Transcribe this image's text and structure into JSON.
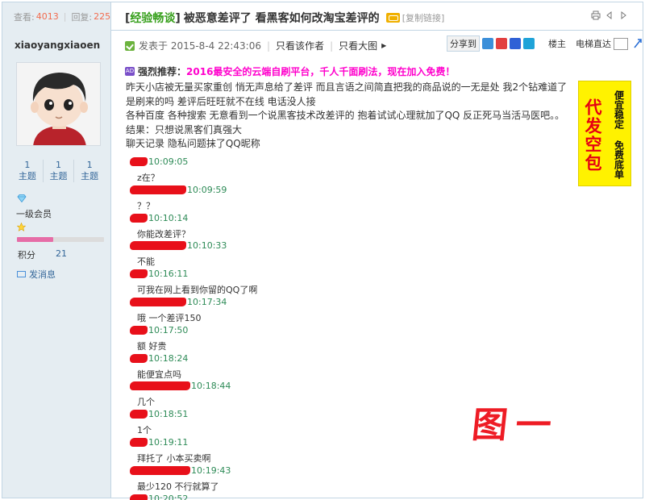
{
  "header": {
    "views_label": "查看:",
    "views_count": "4013",
    "replies_label": "回复:",
    "replies_count": "225",
    "category_open": "[",
    "category": "经验畅谈",
    "category_close": "]",
    "title": "被恶意差评了 看黑客如何改淘宝差评的",
    "copy_link": "[复制链接]",
    "icons": [
      "print-icon",
      "prev-thread-icon",
      "next-thread-icon"
    ]
  },
  "user": {
    "name": "xiaoyangxiaoen",
    "stats": [
      {
        "value": "1",
        "label": "主题"
      },
      {
        "value": "1",
        "label": "主题"
      },
      {
        "value": "1",
        "label": "主题"
      }
    ],
    "level": "一级会员",
    "level_progress": 0.42,
    "score_label": "积分",
    "score": "21",
    "message_label": "发消息"
  },
  "post": {
    "posted_at": "发表于 2015-8-4 22:43:06",
    "author_only": "只看该作者",
    "large_image": "只看大图",
    "share_label": "分享到",
    "share_icons": [
      "qzone-icon",
      "weibo-icon",
      "baidu-icon",
      "tencent-weibo-icon"
    ],
    "floor_label": "楼主",
    "jump_label": "电梯直达",
    "recommend_label": "强烈推荐：",
    "recommend_text": "2016最安全的云端自刷平台，千人千面刷法，现在加入免费！",
    "paragraphs": [
      "昨天小店被无量买家重创 悄无声息给了差评 而且言语之间简直把我的商品说的一无是处 我2个钻难道了是刷来的吗 差评后旺旺就不在线 电话没人接",
      "各种百度 各种搜索 无意看到一个说黑客技术改差评的 抱着试试心理就加了QQ 反正死马当活马医吧。。结果：只想说黑客们真强大",
      "聊天记录 隐私问题抹了QQ昵称"
    ]
  },
  "ad": {
    "big_text": "代发空包",
    "small_text": "便宜稳定 免费底单",
    "bg_color": "#fff200",
    "text_color": "#e60012"
  },
  "chat": [
    {
      "time": "10:09:05",
      "message": "z在？"
    },
    {
      "time": "10:09:59",
      "message": "？？"
    },
    {
      "time": "10:10:14",
      "message": "你能改差评？"
    },
    {
      "time": "10:10:33",
      "message": "不能"
    },
    {
      "time": "10:16:11",
      "message": "可我在网上看到你留的QQ了啊"
    },
    {
      "time": "10:17:34",
      "message": "哦 一个差评150"
    },
    {
      "time": "10:17:50",
      "message": "额 好贵"
    },
    {
      "time": "10:18:24",
      "message": "能便宜点吗"
    },
    {
      "time": "10:18:44",
      "message": "几个"
    },
    {
      "time": "10:18:51",
      "message": "1个"
    },
    {
      "time": "10:19:11",
      "message": "拜托了 小本买卖啊"
    },
    {
      "time": "10:19:43",
      "message": "最少120 不行就算了"
    },
    {
      "time": "10:20:52",
      "message": ""
    }
  ],
  "figure_label": "图一",
  "colors": {
    "sidebar_bg": "#e5edf2",
    "border": "#c2d5e3",
    "category_green": "#369f1b",
    "link_blue": "#336699",
    "recommend_pink": "#ff00cc",
    "timestamp_green": "#2e8b57",
    "redaction_red": "#e8101a"
  }
}
